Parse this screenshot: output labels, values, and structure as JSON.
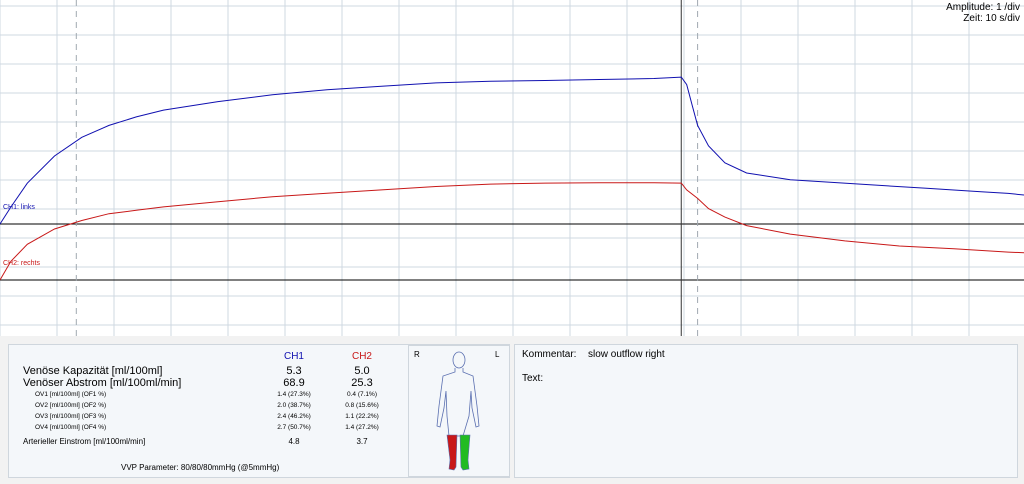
{
  "scale": {
    "amplitude": "Amplitude: 1 /div",
    "zeit": "Zeit: 10 s/div"
  },
  "channels": {
    "ch1_label": "CH1: links",
    "ch2_label": "CH2: rechts",
    "ch1_color": "#1010b0",
    "ch2_color": "#c81818"
  },
  "chart_data": {
    "type": "line",
    "title": "",
    "xlabel": "",
    "ylabel": "",
    "grid": true,
    "series": [
      {
        "name": "CH1: links",
        "color": "#1010b0",
        "points": [
          [
            0,
            0
          ],
          [
            2,
            0.5
          ],
          [
            5,
            1.2
          ],
          [
            10,
            2.0
          ],
          [
            15,
            2.55
          ],
          [
            20,
            2.9
          ],
          [
            25,
            3.15
          ],
          [
            30,
            3.35
          ],
          [
            40,
            3.6
          ],
          [
            50,
            3.8
          ],
          [
            60,
            3.95
          ],
          [
            70,
            4.05
          ],
          [
            80,
            4.15
          ],
          [
            90,
            4.2
          ],
          [
            100,
            4.22
          ],
          [
            110,
            4.25
          ],
          [
            120,
            4.28
          ],
          [
            125,
            4.32
          ],
          [
            126,
            4.1
          ],
          [
            127,
            3.5
          ],
          [
            128,
            2.9
          ],
          [
            130,
            2.3
          ],
          [
            133,
            1.8
          ],
          [
            137,
            1.5
          ],
          [
            145,
            1.3
          ],
          [
            160,
            1.15
          ],
          [
            170,
            1.05
          ],
          [
            180,
            0.95
          ],
          [
            185,
            0.9
          ],
          [
            188,
            0.85
          ]
        ]
      },
      {
        "name": "CH2: rechts",
        "color": "#c81818",
        "points": [
          [
            0,
            0
          ],
          [
            2,
            0.55
          ],
          [
            5,
            1.05
          ],
          [
            10,
            1.5
          ],
          [
            15,
            1.75
          ],
          [
            20,
            1.95
          ],
          [
            25,
            2.05
          ],
          [
            30,
            2.15
          ],
          [
            40,
            2.3
          ],
          [
            50,
            2.45
          ],
          [
            60,
            2.55
          ],
          [
            70,
            2.65
          ],
          [
            80,
            2.75
          ],
          [
            90,
            2.82
          ],
          [
            100,
            2.85
          ],
          [
            110,
            2.86
          ],
          [
            120,
            2.86
          ],
          [
            125,
            2.85
          ],
          [
            126,
            2.65
          ],
          [
            128,
            2.4
          ],
          [
            130,
            2.1
          ],
          [
            133,
            1.85
          ],
          [
            137,
            1.6
          ],
          [
            145,
            1.35
          ],
          [
            155,
            1.15
          ],
          [
            165,
            1.0
          ],
          [
            175,
            0.92
          ],
          [
            185,
            0.82
          ],
          [
            188,
            0.8
          ]
        ]
      }
    ],
    "markers_x": [
      14,
      125,
      128
    ]
  },
  "results": {
    "col_ch1": "CH1",
    "col_ch2": "CH2",
    "rows": [
      {
        "label": "Venöse Kapazität [ml/100ml]",
        "ch1": "5.3",
        "ch2": "5.0",
        "size": "big"
      },
      {
        "label": "Venöser Abstrom [ml/100ml/min]",
        "ch1": "68.9",
        "ch2": "25.3",
        "size": "big"
      },
      {
        "label": "OV1 [ml/100ml] (OF1 %)",
        "ch1": "1.4 (27.3%)",
        "ch2": "0.4 (7.1%)",
        "size": "small"
      },
      {
        "label": "OV2 [ml/100ml] (OF2 %)",
        "ch1": "2.0 (38.7%)",
        "ch2": "0.8 (15.6%)",
        "size": "small"
      },
      {
        "label": "OV3 [ml/100ml] (OF3 %)",
        "ch1": "2.4 (46.2%)",
        "ch2": "1.1 (22.2%)",
        "size": "small"
      },
      {
        "label": "OV4 [ml/100ml] (OF4 %)",
        "ch1": "2.7 (50.7%)",
        "ch2": "1.4 (27.2%)",
        "size": "small"
      },
      {
        "label": "Arterieller Einstrom [ml/100ml/min]",
        "ch1": "4.8",
        "ch2": "3.7",
        "size": "mid"
      }
    ],
    "vvp": "VVP Parameter: 80/80/80mmHg (@5mmHg)"
  },
  "body_figure": {
    "left_label": "R",
    "right_label": "L",
    "right_leg_color": "#c81818",
    "left_leg_color": "#22bb22"
  },
  "comment": {
    "label": "Kommentar:",
    "value": "slow outflow right",
    "text_label": "Text:",
    "text_value": ""
  }
}
